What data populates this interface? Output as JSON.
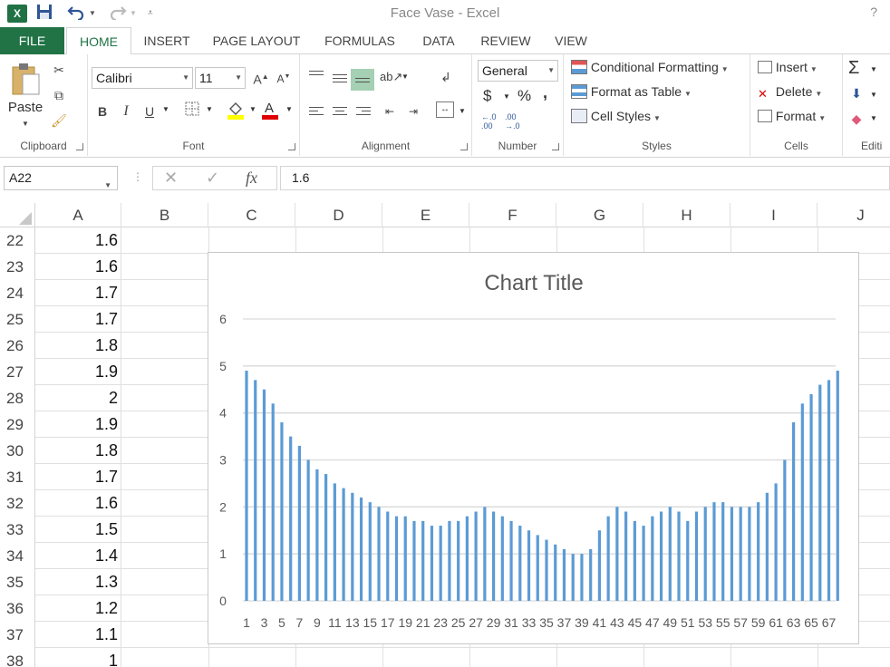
{
  "app": {
    "window_title": "Face Vase - Excel",
    "logo_text": "X",
    "help": "?"
  },
  "quick_access": {
    "save_icon": "save-icon",
    "undo_icon": "undo-icon",
    "redo_icon": "redo-icon"
  },
  "ribbon_tabs": [
    "FILE",
    "HOME",
    "INSERT",
    "PAGE LAYOUT",
    "FORMULAS",
    "DATA",
    "REVIEW",
    "VIEW"
  ],
  "ribbon": {
    "clipboard": {
      "paste": "Paste",
      "label": "Clipboard"
    },
    "font": {
      "name": "Calibri",
      "size": "11",
      "bold": "B",
      "italic": "I",
      "underline": "U",
      "label": "Font"
    },
    "alignment": {
      "label": "Alignment"
    },
    "number": {
      "format": "General",
      "currency": "$",
      "percent": "%",
      "comma": ",",
      "inc_decimal": "←.0\n.00",
      "dec_decimal": ".00\n→.0",
      "label": "Number"
    },
    "styles": {
      "conditional": "Conditional Formatting",
      "table": "Format as Table",
      "cell": "Cell Styles",
      "label": "Styles"
    },
    "cells": {
      "insert": "Insert",
      "delete": "Delete",
      "format": "Format",
      "label": "Cells"
    },
    "editing": {
      "sum": "Σ",
      "label": "Editi"
    }
  },
  "formula_bar": {
    "name_box": "A22",
    "cancel": "✕",
    "enter": "✓",
    "fx": "fx",
    "value": "1.6"
  },
  "columns": [
    "A",
    "B",
    "C",
    "D",
    "E",
    "F",
    "G",
    "H",
    "I",
    "J"
  ],
  "rows": [
    {
      "num": "22",
      "a": "1.6"
    },
    {
      "num": "23",
      "a": "1.6"
    },
    {
      "num": "24",
      "a": "1.7"
    },
    {
      "num": "25",
      "a": "1.7"
    },
    {
      "num": "26",
      "a": "1.8"
    },
    {
      "num": "27",
      "a": "1.9"
    },
    {
      "num": "28",
      "a": "2"
    },
    {
      "num": "29",
      "a": "1.9"
    },
    {
      "num": "30",
      "a": "1.8"
    },
    {
      "num": "31",
      "a": "1.7"
    },
    {
      "num": "32",
      "a": "1.6"
    },
    {
      "num": "33",
      "a": "1.5"
    },
    {
      "num": "34",
      "a": "1.4"
    },
    {
      "num": "35",
      "a": "1.3"
    },
    {
      "num": "36",
      "a": "1.2"
    },
    {
      "num": "37",
      "a": "1.1"
    },
    {
      "num": "38",
      "a": "1"
    }
  ],
  "chart_data": {
    "type": "bar",
    "title": "Chart Title",
    "ylim": [
      0,
      6
    ],
    "yticks": [
      0,
      1,
      2,
      3,
      4,
      5,
      6
    ],
    "grid": true,
    "bar_color": "#5b9bd5",
    "categories": [
      "1",
      "2",
      "3",
      "4",
      "5",
      "6",
      "7",
      "8",
      "9",
      "10",
      "11",
      "12",
      "13",
      "14",
      "15",
      "16",
      "17",
      "18",
      "19",
      "20",
      "21",
      "22",
      "23",
      "24",
      "25",
      "26",
      "27",
      "28",
      "29",
      "30",
      "31",
      "32",
      "33",
      "34",
      "35",
      "36",
      "37",
      "38",
      "39",
      "40",
      "41",
      "42",
      "43",
      "44",
      "45",
      "46",
      "47",
      "48",
      "49",
      "50",
      "51",
      "52",
      "53",
      "54",
      "55",
      "56",
      "57",
      "58",
      "59",
      "60",
      "61",
      "62",
      "63",
      "64",
      "65",
      "66",
      "67",
      "68"
    ],
    "xtick_labels": [
      "1",
      "3",
      "5",
      "7",
      "9",
      "11",
      "13",
      "15",
      "17",
      "19",
      "21",
      "23",
      "25",
      "27",
      "29",
      "31",
      "33",
      "35",
      "37",
      "39",
      "41",
      "43",
      "45",
      "47",
      "49",
      "51",
      "53",
      "55",
      "57",
      "59",
      "61",
      "63",
      "65",
      "67"
    ],
    "values": [
      4.9,
      4.7,
      4.5,
      4.2,
      3.8,
      3.5,
      3.3,
      3.0,
      2.8,
      2.7,
      2.5,
      2.4,
      2.3,
      2.2,
      2.1,
      2.0,
      1.9,
      1.8,
      1.8,
      1.7,
      1.7,
      1.6,
      1.6,
      1.7,
      1.7,
      1.8,
      1.9,
      2.0,
      1.9,
      1.8,
      1.7,
      1.6,
      1.5,
      1.4,
      1.3,
      1.2,
      1.1,
      1.0,
      1.0,
      1.1,
      1.5,
      1.8,
      2.0,
      1.9,
      1.7,
      1.6,
      1.8,
      1.9,
      2.0,
      1.9,
      1.7,
      1.9,
      2.0,
      2.1,
      2.1,
      2.0,
      2.0,
      2.0,
      2.1,
      2.3,
      2.5,
      3.0,
      3.8,
      4.2,
      4.4,
      4.6,
      4.7,
      4.9
    ]
  }
}
